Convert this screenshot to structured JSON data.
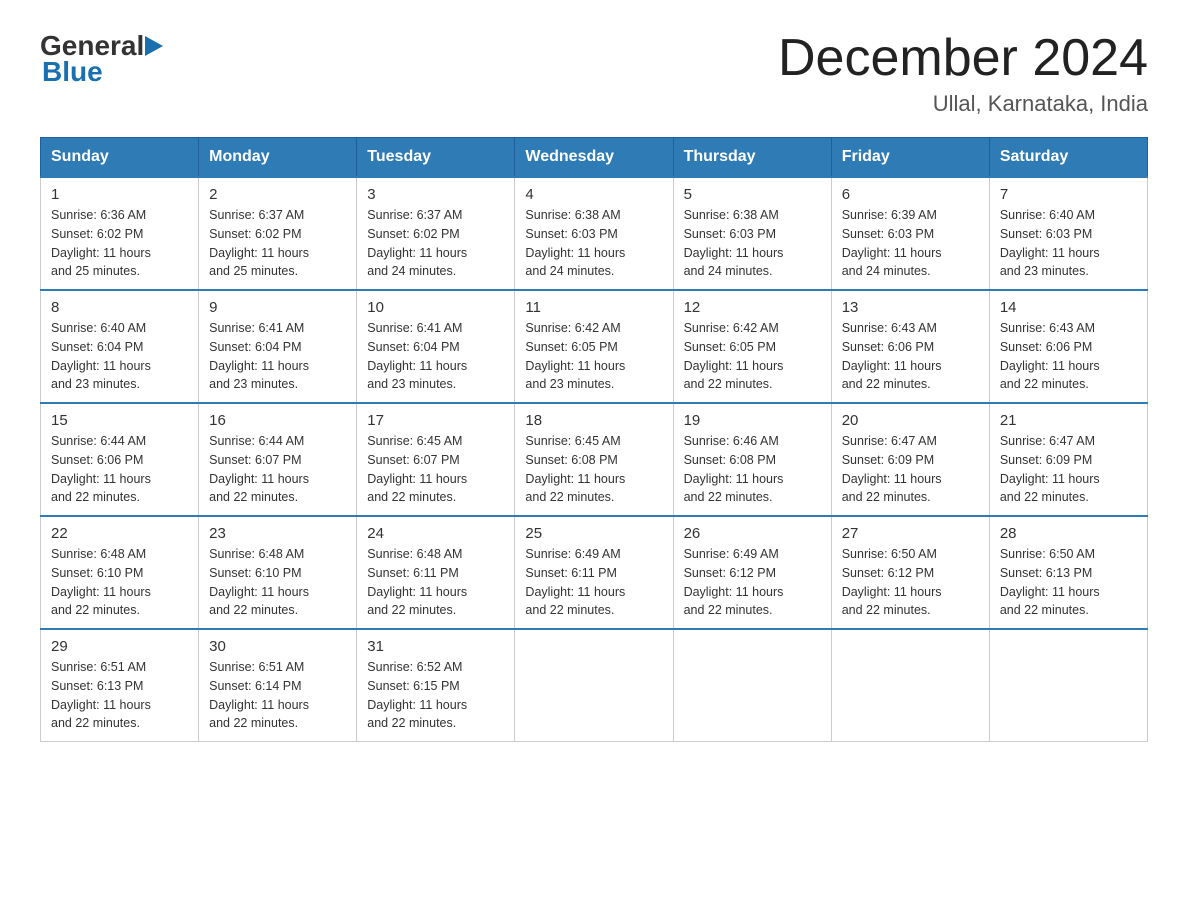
{
  "logo": {
    "general": "General",
    "blue": "Blue"
  },
  "title": "December 2024",
  "subtitle": "Ullal, Karnataka, India",
  "days_of_week": [
    "Sunday",
    "Monday",
    "Tuesday",
    "Wednesday",
    "Thursday",
    "Friday",
    "Saturday"
  ],
  "weeks": [
    [
      {
        "day": "1",
        "sunrise": "6:36 AM",
        "sunset": "6:02 PM",
        "daylight": "11 hours and 25 minutes."
      },
      {
        "day": "2",
        "sunrise": "6:37 AM",
        "sunset": "6:02 PM",
        "daylight": "11 hours and 25 minutes."
      },
      {
        "day": "3",
        "sunrise": "6:37 AM",
        "sunset": "6:02 PM",
        "daylight": "11 hours and 24 minutes."
      },
      {
        "day": "4",
        "sunrise": "6:38 AM",
        "sunset": "6:03 PM",
        "daylight": "11 hours and 24 minutes."
      },
      {
        "day": "5",
        "sunrise": "6:38 AM",
        "sunset": "6:03 PM",
        "daylight": "11 hours and 24 minutes."
      },
      {
        "day": "6",
        "sunrise": "6:39 AM",
        "sunset": "6:03 PM",
        "daylight": "11 hours and 24 minutes."
      },
      {
        "day": "7",
        "sunrise": "6:40 AM",
        "sunset": "6:03 PM",
        "daylight": "11 hours and 23 minutes."
      }
    ],
    [
      {
        "day": "8",
        "sunrise": "6:40 AM",
        "sunset": "6:04 PM",
        "daylight": "11 hours and 23 minutes."
      },
      {
        "day": "9",
        "sunrise": "6:41 AM",
        "sunset": "6:04 PM",
        "daylight": "11 hours and 23 minutes."
      },
      {
        "day": "10",
        "sunrise": "6:41 AM",
        "sunset": "6:04 PM",
        "daylight": "11 hours and 23 minutes."
      },
      {
        "day": "11",
        "sunrise": "6:42 AM",
        "sunset": "6:05 PM",
        "daylight": "11 hours and 23 minutes."
      },
      {
        "day": "12",
        "sunrise": "6:42 AM",
        "sunset": "6:05 PM",
        "daylight": "11 hours and 22 minutes."
      },
      {
        "day": "13",
        "sunrise": "6:43 AM",
        "sunset": "6:06 PM",
        "daylight": "11 hours and 22 minutes."
      },
      {
        "day": "14",
        "sunrise": "6:43 AM",
        "sunset": "6:06 PM",
        "daylight": "11 hours and 22 minutes."
      }
    ],
    [
      {
        "day": "15",
        "sunrise": "6:44 AM",
        "sunset": "6:06 PM",
        "daylight": "11 hours and 22 minutes."
      },
      {
        "day": "16",
        "sunrise": "6:44 AM",
        "sunset": "6:07 PM",
        "daylight": "11 hours and 22 minutes."
      },
      {
        "day": "17",
        "sunrise": "6:45 AM",
        "sunset": "6:07 PM",
        "daylight": "11 hours and 22 minutes."
      },
      {
        "day": "18",
        "sunrise": "6:45 AM",
        "sunset": "6:08 PM",
        "daylight": "11 hours and 22 minutes."
      },
      {
        "day": "19",
        "sunrise": "6:46 AM",
        "sunset": "6:08 PM",
        "daylight": "11 hours and 22 minutes."
      },
      {
        "day": "20",
        "sunrise": "6:47 AM",
        "sunset": "6:09 PM",
        "daylight": "11 hours and 22 minutes."
      },
      {
        "day": "21",
        "sunrise": "6:47 AM",
        "sunset": "6:09 PM",
        "daylight": "11 hours and 22 minutes."
      }
    ],
    [
      {
        "day": "22",
        "sunrise": "6:48 AM",
        "sunset": "6:10 PM",
        "daylight": "11 hours and 22 minutes."
      },
      {
        "day": "23",
        "sunrise": "6:48 AM",
        "sunset": "6:10 PM",
        "daylight": "11 hours and 22 minutes."
      },
      {
        "day": "24",
        "sunrise": "6:48 AM",
        "sunset": "6:11 PM",
        "daylight": "11 hours and 22 minutes."
      },
      {
        "day": "25",
        "sunrise": "6:49 AM",
        "sunset": "6:11 PM",
        "daylight": "11 hours and 22 minutes."
      },
      {
        "day": "26",
        "sunrise": "6:49 AM",
        "sunset": "6:12 PM",
        "daylight": "11 hours and 22 minutes."
      },
      {
        "day": "27",
        "sunrise": "6:50 AM",
        "sunset": "6:12 PM",
        "daylight": "11 hours and 22 minutes."
      },
      {
        "day": "28",
        "sunrise": "6:50 AM",
        "sunset": "6:13 PM",
        "daylight": "11 hours and 22 minutes."
      }
    ],
    [
      {
        "day": "29",
        "sunrise": "6:51 AM",
        "sunset": "6:13 PM",
        "daylight": "11 hours and 22 minutes."
      },
      {
        "day": "30",
        "sunrise": "6:51 AM",
        "sunset": "6:14 PM",
        "daylight": "11 hours and 22 minutes."
      },
      {
        "day": "31",
        "sunrise": "6:52 AM",
        "sunset": "6:15 PM",
        "daylight": "11 hours and 22 minutes."
      },
      null,
      null,
      null,
      null
    ]
  ],
  "labels": {
    "sunrise": "Sunrise:",
    "sunset": "Sunset:",
    "daylight": "Daylight:"
  }
}
